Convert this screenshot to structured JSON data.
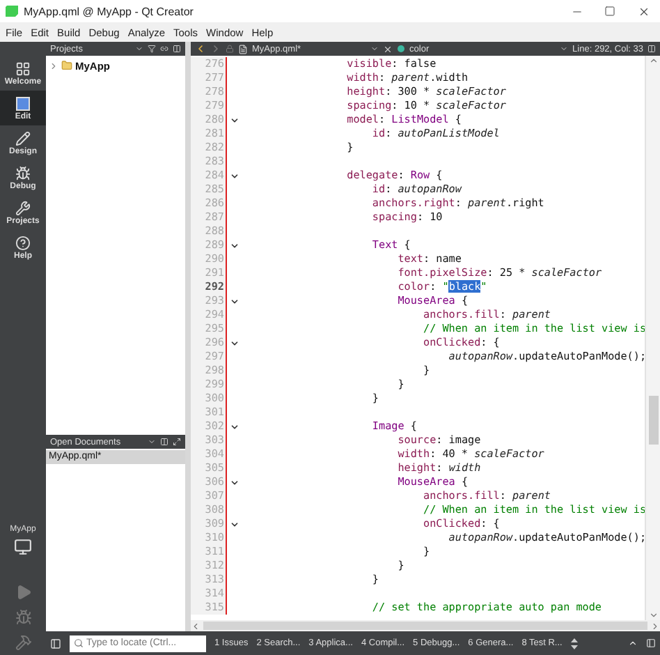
{
  "window": {
    "title": "MyApp.qml @ MyApp - Qt Creator"
  },
  "menu": [
    "File",
    "Edit",
    "Build",
    "Debug",
    "Analyze",
    "Tools",
    "Window",
    "Help"
  ],
  "modes": [
    {
      "label": "Welcome",
      "selected": false
    },
    {
      "label": "Edit",
      "selected": true
    },
    {
      "label": "Design",
      "selected": false
    },
    {
      "label": "Debug",
      "selected": false
    },
    {
      "label": "Projects",
      "selected": false
    },
    {
      "label": "Help",
      "selected": false
    }
  ],
  "target": {
    "label": "MyApp"
  },
  "projects_pane": {
    "title": "Projects",
    "tree": [
      {
        "label": "MyApp",
        "expanded": false
      }
    ]
  },
  "open_documents": {
    "title": "Open Documents",
    "items": [
      {
        "label": "MyApp.qml*",
        "selected": true
      }
    ]
  },
  "editor": {
    "file": "MyApp.qml*",
    "symbol": "color",
    "position": "Line: 292, Col: 33",
    "lines": [
      {
        "number": "276",
        "fold": false,
        "current": false,
        "tokens": [
          {
            "kind": "prop",
            "t": "                visible"
          },
          {
            "kind": "plain",
            "t": ": false"
          }
        ]
      },
      {
        "number": "277",
        "fold": false,
        "current": false,
        "tokens": [
          {
            "kind": "prop",
            "t": "                width"
          },
          {
            "kind": "plain",
            "t": ": "
          },
          {
            "kind": "ident",
            "t": "parent"
          },
          {
            "kind": "plain",
            "t": ".width"
          }
        ]
      },
      {
        "number": "278",
        "fold": false,
        "current": false,
        "tokens": [
          {
            "kind": "prop",
            "t": "                height"
          },
          {
            "kind": "plain",
            "t": ": 300 * "
          },
          {
            "kind": "ident",
            "t": "scaleFactor"
          }
        ]
      },
      {
        "number": "279",
        "fold": false,
        "current": false,
        "tokens": [
          {
            "kind": "prop",
            "t": "                spacing"
          },
          {
            "kind": "plain",
            "t": ": 10 * "
          },
          {
            "kind": "ident",
            "t": "scaleFactor"
          }
        ]
      },
      {
        "number": "280",
        "fold": true,
        "current": false,
        "tokens": [
          {
            "kind": "prop",
            "t": "                model"
          },
          {
            "kind": "plain",
            "t": ": "
          },
          {
            "kind": "type",
            "t": "ListModel"
          },
          {
            "kind": "plain",
            "t": " {"
          }
        ]
      },
      {
        "number": "281",
        "fold": false,
        "current": false,
        "tokens": [
          {
            "kind": "prop",
            "t": "                    id"
          },
          {
            "kind": "plain",
            "t": ": "
          },
          {
            "kind": "ident",
            "t": "autoPanListModel"
          }
        ]
      },
      {
        "number": "282",
        "fold": false,
        "current": false,
        "tokens": [
          {
            "kind": "plain",
            "t": "                }"
          }
        ]
      },
      {
        "number": "283",
        "fold": false,
        "current": false
      },
      {
        "number": "284",
        "fold": true,
        "current": false,
        "tokens": [
          {
            "kind": "prop",
            "t": "                delegate"
          },
          {
            "kind": "plain",
            "t": ": "
          },
          {
            "kind": "type",
            "t": "Row"
          },
          {
            "kind": "plain",
            "t": " {"
          }
        ]
      },
      {
        "number": "285",
        "fold": false,
        "current": false,
        "tokens": [
          {
            "kind": "prop",
            "t": "                    id"
          },
          {
            "kind": "plain",
            "t": ": "
          },
          {
            "kind": "ident",
            "t": "autopanRow"
          }
        ]
      },
      {
        "number": "286",
        "fold": false,
        "current": false,
        "tokens": [
          {
            "kind": "prop",
            "t": "                    anchors.right"
          },
          {
            "kind": "plain",
            "t": ": "
          },
          {
            "kind": "ident",
            "t": "parent"
          },
          {
            "kind": "plain",
            "t": ".right"
          }
        ]
      },
      {
        "number": "287",
        "fold": false,
        "current": false,
        "tokens": [
          {
            "kind": "prop",
            "t": "                    spacing"
          },
          {
            "kind": "plain",
            "t": ": 10"
          }
        ]
      },
      {
        "number": "288",
        "fold": false,
        "current": false
      },
      {
        "number": "289",
        "fold": true,
        "current": false,
        "tokens": [
          {
            "kind": "type",
            "t": "                    Text"
          },
          {
            "kind": "plain",
            "t": " {"
          }
        ]
      },
      {
        "number": "290",
        "fold": false,
        "current": false,
        "tokens": [
          {
            "kind": "prop",
            "t": "                        text"
          },
          {
            "kind": "plain",
            "t": ": name"
          }
        ]
      },
      {
        "number": "291",
        "fold": false,
        "current": false,
        "tokens": [
          {
            "kind": "prop",
            "t": "                        font.pixelSize"
          },
          {
            "kind": "plain",
            "t": ": 25 * "
          },
          {
            "kind": "ident",
            "t": "scaleFactor"
          }
        ]
      },
      {
        "number": "292",
        "fold": false,
        "current": true,
        "tokens": [
          {
            "kind": "prop",
            "t": "                        color"
          },
          {
            "kind": "plain",
            "t": ": "
          },
          {
            "kind": "string",
            "t": "\""
          },
          {
            "kind": "selected",
            "t": "black"
          },
          {
            "kind": "string",
            "t": "\""
          }
        ]
      },
      {
        "number": "293",
        "fold": true,
        "current": false,
        "tokens": [
          {
            "kind": "type",
            "t": "                        MouseArea"
          },
          {
            "kind": "plain",
            "t": " {"
          }
        ]
      },
      {
        "number": "294",
        "fold": false,
        "current": false,
        "tokens": [
          {
            "kind": "prop",
            "t": "                            anchors.fill"
          },
          {
            "kind": "plain",
            "t": ": "
          },
          {
            "kind": "ident",
            "t": "parent"
          }
        ]
      },
      {
        "number": "295",
        "fold": false,
        "current": false,
        "tokens": [
          {
            "kind": "comment",
            "t": "                            // When an item in the list view is"
          }
        ]
      },
      {
        "number": "296",
        "fold": true,
        "current": false,
        "tokens": [
          {
            "kind": "prop",
            "t": "                            onClicked"
          },
          {
            "kind": "plain",
            "t": ": {"
          }
        ]
      },
      {
        "number": "297",
        "fold": false,
        "current": false,
        "tokens": [
          {
            "kind": "ident",
            "t": "                                autopanRow"
          },
          {
            "kind": "plain",
            "t": ".updateAutoPanMode();"
          }
        ]
      },
      {
        "number": "298",
        "fold": false,
        "current": false,
        "tokens": [
          {
            "kind": "plain",
            "t": "                            }"
          }
        ]
      },
      {
        "number": "299",
        "fold": false,
        "current": false,
        "tokens": [
          {
            "kind": "plain",
            "t": "                        }"
          }
        ]
      },
      {
        "number": "300",
        "fold": false,
        "current": false,
        "tokens": [
          {
            "kind": "plain",
            "t": "                    }"
          }
        ]
      },
      {
        "number": "301",
        "fold": false,
        "current": false
      },
      {
        "number": "302",
        "fold": true,
        "current": false,
        "tokens": [
          {
            "kind": "type",
            "t": "                    Image"
          },
          {
            "kind": "plain",
            "t": " {"
          }
        ]
      },
      {
        "number": "303",
        "fold": false,
        "current": false,
        "tokens": [
          {
            "kind": "prop",
            "t": "                        source"
          },
          {
            "kind": "plain",
            "t": ": image"
          }
        ]
      },
      {
        "number": "304",
        "fold": false,
        "current": false,
        "tokens": [
          {
            "kind": "prop",
            "t": "                        width"
          },
          {
            "kind": "plain",
            "t": ": 40 * "
          },
          {
            "kind": "ident",
            "t": "scaleFactor"
          }
        ]
      },
      {
        "number": "305",
        "fold": false,
        "current": false,
        "tokens": [
          {
            "kind": "prop",
            "t": "                        height"
          },
          {
            "kind": "plain",
            "t": ": "
          },
          {
            "kind": "ident",
            "t": "width"
          }
        ]
      },
      {
        "number": "306",
        "fold": true,
        "current": false,
        "tokens": [
          {
            "kind": "type",
            "t": "                        MouseArea"
          },
          {
            "kind": "plain",
            "t": " {"
          }
        ]
      },
      {
        "number": "307",
        "fold": false,
        "current": false,
        "tokens": [
          {
            "kind": "prop",
            "t": "                            anchors.fill"
          },
          {
            "kind": "plain",
            "t": ": "
          },
          {
            "kind": "ident",
            "t": "parent"
          }
        ]
      },
      {
        "number": "308",
        "fold": false,
        "current": false,
        "tokens": [
          {
            "kind": "comment",
            "t": "                            // When an item in the list view is"
          }
        ]
      },
      {
        "number": "309",
        "fold": true,
        "current": false,
        "tokens": [
          {
            "kind": "prop",
            "t": "                            onClicked"
          },
          {
            "kind": "plain",
            "t": ": {"
          }
        ]
      },
      {
        "number": "310",
        "fold": false,
        "current": false,
        "tokens": [
          {
            "kind": "ident",
            "t": "                                autopanRow"
          },
          {
            "kind": "plain",
            "t": ".updateAutoPanMode();"
          }
        ]
      },
      {
        "number": "311",
        "fold": false,
        "current": false,
        "tokens": [
          {
            "kind": "plain",
            "t": "                            }"
          }
        ]
      },
      {
        "number": "312",
        "fold": false,
        "current": false,
        "tokens": [
          {
            "kind": "plain",
            "t": "                        }"
          }
        ]
      },
      {
        "number": "313",
        "fold": false,
        "current": false,
        "tokens": [
          {
            "kind": "plain",
            "t": "                    }"
          }
        ]
      },
      {
        "number": "314",
        "fold": false,
        "current": false
      },
      {
        "number": "315",
        "fold": false,
        "current": false,
        "tokens": [
          {
            "kind": "comment",
            "t": "                    // set the appropriate auto pan mode"
          }
        ]
      }
    ]
  },
  "locator": {
    "placeholder": "Type to locate (Ctrl..."
  },
  "output_tabs": [
    "1 Issues",
    "2 Search...",
    "3 Applica...",
    "4 Compil...",
    "5 Debugg...",
    "6 Genera...",
    "8 Test R..."
  ]
}
